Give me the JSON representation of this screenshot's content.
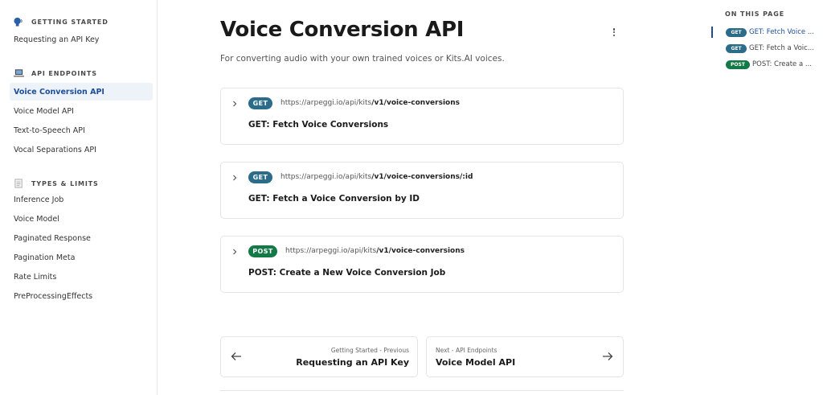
{
  "sidebar": {
    "sections": [
      {
        "title": "GETTING STARTED",
        "icon": "speaking-head-icon",
        "items": [
          "Requesting an API Key"
        ]
      },
      {
        "title": "API ENDPOINTS",
        "icon": "laptop-icon",
        "items": [
          "Voice Conversion API",
          "Voice Model API",
          "Text-to-Speech API",
          "Vocal Separations API"
        ]
      },
      {
        "title": "TYPES & LIMITS",
        "icon": "memo-icon",
        "items": [
          "Inference Job",
          "Voice Model",
          "Paginated Response",
          "Pagination Meta",
          "Rate Limits",
          "PreProcessingEffects"
        ]
      }
    ],
    "active_item": "Voice Conversion API"
  },
  "main": {
    "title": "Voice Conversion API",
    "subtitle": "For converting audio with your own trained voices or Kits.AI voices.",
    "endpoints": [
      {
        "method": "GET",
        "url_base": "https://arpeggi.io/api/kits",
        "url_path": "/v1/voice-conversions",
        "title": "GET: Fetch Voice Conversions"
      },
      {
        "method": "GET",
        "url_base": "https://arpeggi.io/api/kits",
        "url_path": "/v1/voice-conversions/:id",
        "title": "GET: Fetch a Voice Conversion by ID"
      },
      {
        "method": "POST",
        "url_base": "https://arpeggi.io/api/kits",
        "url_path": "/v1/voice-conversions",
        "title": "POST: Create a New Voice Conversion Job"
      }
    ],
    "pager": {
      "prev_small": "Getting Started - Previous",
      "prev_big": "Requesting an API Key",
      "next_small": "Next - API Endpoints",
      "next_big": "Voice Model API"
    }
  },
  "toc": {
    "title": "ON THIS PAGE",
    "items": [
      {
        "method": "GET",
        "label": "GET: Fetch Voice ..."
      },
      {
        "method": "GET",
        "label": "GET: Fetch a Voic..."
      },
      {
        "method": "POST",
        "label": "POST: Create a ..."
      }
    ]
  },
  "colors": {
    "accent": "#1c4e9c",
    "get_badge": "#2a6c8a",
    "post_badge": "#137a47",
    "active_bg": "#eef3fa"
  }
}
